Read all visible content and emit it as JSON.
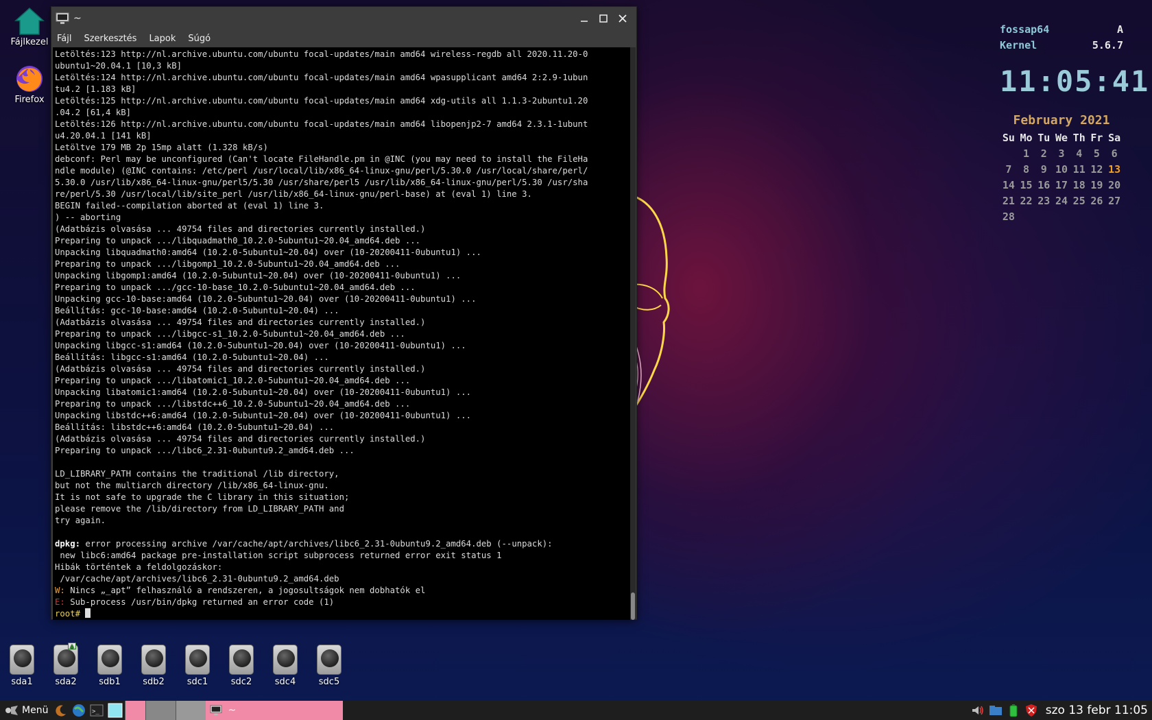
{
  "desktop": {
    "icons": [
      {
        "label": "Fájlkezel",
        "icon": "home-folder-icon"
      },
      {
        "label": "Firefox",
        "icon": "firefox-icon"
      }
    ],
    "drives": [
      "sda1",
      "sda2",
      "sdb1",
      "sdb2",
      "sdc1",
      "sdc2",
      "sdc4",
      "sdc5"
    ]
  },
  "terminal": {
    "title": "~",
    "menu": [
      "Fájl",
      "Szerkesztés",
      "Lapok",
      "Súgó"
    ],
    "lines": [
      "Letöltés:123 http://nl.archive.ubuntu.com/ubuntu focal-updates/main amd64 wireless-regdb all 2020.11.20-0",
      "ubuntu1~20.04.1 [10,3 kB]",
      "Letöltés:124 http://nl.archive.ubuntu.com/ubuntu focal-updates/main amd64 wpasupplicant amd64 2:2.9-1ubun",
      "tu4.2 [1.183 kB]",
      "Letöltés:125 http://nl.archive.ubuntu.com/ubuntu focal-updates/main amd64 xdg-utils all 1.1.3-2ubuntu1.20",
      ".04.2 [61,4 kB]",
      "Letöltés:126 http://nl.archive.ubuntu.com/ubuntu focal-updates/main amd64 libopenjp2-7 amd64 2.3.1-1ubunt",
      "u4.20.04.1 [141 kB]",
      "Letöltve 179 MB 2p 15mp alatt (1.328 kB/s)",
      "debconf: Perl may be unconfigured (Can't locate FileHandle.pm in @INC (you may need to install the FileHa",
      "ndle module) (@INC contains: /etc/perl /usr/local/lib/x86_64-linux-gnu/perl/5.30.0 /usr/local/share/perl/",
      "5.30.0 /usr/lib/x86_64-linux-gnu/perl5/5.30 /usr/share/perl5 /usr/lib/x86_64-linux-gnu/perl/5.30 /usr/sha",
      "re/perl/5.30 /usr/local/lib/site_perl /usr/lib/x86_64-linux-gnu/perl-base) at (eval 1) line 3.",
      "BEGIN failed--compilation aborted at (eval 1) line 3.",
      ") -- aborting",
      "(Adatbázis olvasása ... 49754 files and directories currently installed.)",
      "Preparing to unpack .../libquadmath0_10.2.0-5ubuntu1~20.04_amd64.deb ...",
      "Unpacking libquadmath0:amd64 (10.2.0-5ubuntu1~20.04) over (10-20200411-0ubuntu1) ...",
      "Preparing to unpack .../libgomp1_10.2.0-5ubuntu1~20.04_amd64.deb ...",
      "Unpacking libgomp1:amd64 (10.2.0-5ubuntu1~20.04) over (10-20200411-0ubuntu1) ...",
      "Preparing to unpack .../gcc-10-base_10.2.0-5ubuntu1~20.04_amd64.deb ...",
      "Unpacking gcc-10-base:amd64 (10.2.0-5ubuntu1~20.04) over (10-20200411-0ubuntu1) ...",
      "Beállítás: gcc-10-base:amd64 (10.2.0-5ubuntu1~20.04) ...",
      "(Adatbázis olvasása ... 49754 files and directories currently installed.)",
      "Preparing to unpack .../libgcc-s1_10.2.0-5ubuntu1~20.04_amd64.deb ...",
      "Unpacking libgcc-s1:amd64 (10.2.0-5ubuntu1~20.04) over (10-20200411-0ubuntu1) ...",
      "Beállítás: libgcc-s1:amd64 (10.2.0-5ubuntu1~20.04) ...",
      "(Adatbázis olvasása ... 49754 files and directories currently installed.)",
      "Preparing to unpack .../libatomic1_10.2.0-5ubuntu1~20.04_amd64.deb ...",
      "Unpacking libatomic1:amd64 (10.2.0-5ubuntu1~20.04) over (10-20200411-0ubuntu1) ...",
      "Preparing to unpack .../libstdc++6_10.2.0-5ubuntu1~20.04_amd64.deb ...",
      "Unpacking libstdc++6:amd64 (10.2.0-5ubuntu1~20.04) over (10-20200411-0ubuntu1) ...",
      "Beállítás: libstdc++6:amd64 (10.2.0-5ubuntu1~20.04) ...",
      "(Adatbázis olvasása ... 49754 files and directories currently installed.)",
      "Preparing to unpack .../libc6_2.31-0ubuntu9.2_amd64.deb ...",
      "",
      "LD_LIBRARY_PATH contains the traditional /lib directory,",
      "but not the multiarch directory /lib/x86_64-linux-gnu.",
      "It is not safe to upgrade the C library in this situation;",
      "please remove the /lib/directory from LD_LIBRARY_PATH and",
      "try again.",
      ""
    ],
    "dpkg_prefix": "dpkg:",
    "dpkg_rest": " error processing archive /var/cache/apt/archives/libc6_2.31-0ubuntu9.2_amd64.deb (--unpack):",
    "tail_lines": [
      " new libc6:amd64 package pre-installation script subprocess returned error exit status 1",
      "Hibák történtek a feldolgozáskor:",
      " /var/cache/apt/archives/libc6_2.31-0ubuntu9.2_amd64.deb"
    ],
    "warn_prefix": "W:",
    "warn_text": " Nincs „_apt” felhasználó a rendszeren, a jogosultságok nem dobhatók el",
    "err_prefix": "E:",
    "err_text": " Sub-process /usr/bin/dpkg returned an error code (1)",
    "prompt": "root#"
  },
  "conky": {
    "host_label": "fossap64",
    "host_value": "A",
    "kernel_label": "Kernel",
    "kernel_value": "5.6.7",
    "time": "11:05:41",
    "month_title": "February  2021",
    "weekdays": [
      "Su",
      "Mo",
      "Tu",
      "We",
      "Th",
      "Fr",
      "Sa"
    ],
    "days": [
      "",
      "1",
      "2",
      "3",
      "4",
      "5",
      "6",
      "7",
      "8",
      "9",
      "10",
      "11",
      "12",
      "13",
      "14",
      "15",
      "16",
      "17",
      "18",
      "19",
      "20",
      "21",
      "22",
      "23",
      "24",
      "25",
      "26",
      "27",
      "28"
    ],
    "today": "13",
    "colors": {
      "label": "#8fc8d8",
      "today": "#f0a020",
      "title": "#d4a862"
    }
  },
  "taskbar": {
    "menu_label": "Menü",
    "active_task_title": "~",
    "clock": "szo 13 febr 11:05",
    "tray_icons": [
      "volume-icon",
      "network-folder-icon",
      "battery-icon",
      "shield-icon"
    ],
    "active_color": "#f08aa6"
  }
}
